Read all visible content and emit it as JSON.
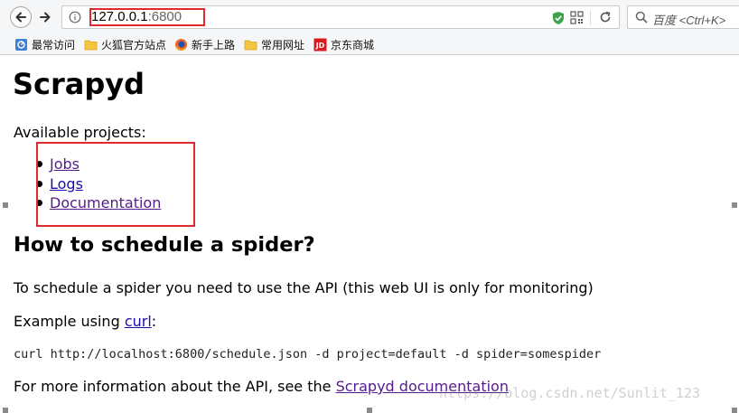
{
  "browser": {
    "url_host": "127.0.0.1",
    "url_port": ":6800",
    "search_placeholder": "百度 <Ctrl+K>"
  },
  "bookmarks": [
    {
      "label": "最常访问",
      "icon": "most-visited-icon"
    },
    {
      "label": "火狐官方站点",
      "icon": "folder-icon"
    },
    {
      "label": "新手上路",
      "icon": "firefox-icon"
    },
    {
      "label": "常用网址",
      "icon": "folder-icon"
    },
    {
      "label": "京东商城",
      "icon": "jd-icon"
    }
  ],
  "page": {
    "title": "Scrapyd",
    "intro": "Available projects:",
    "links": [
      {
        "label": "Jobs"
      },
      {
        "label": "Logs"
      },
      {
        "label": "Documentation"
      }
    ],
    "heading": "How to schedule a spider?",
    "schedule_text": "To schedule a spider you need to use the API (this web UI is only for monitoring)",
    "example_prefix": "Example using ",
    "example_link": "curl",
    "example_suffix": ":",
    "code_example": "curl http://localhost:6800/schedule.json -d project=default -d spider=somespider",
    "more_info_prefix": "For more information about the API, see the ",
    "more_info_link": "Scrapyd documentation"
  },
  "watermark": "https://blog.csdn.net/Sunlit_123",
  "colors": {
    "highlight_red": "#e0282d",
    "link_visited": "#551a8b",
    "link_unvisited": "#1a0dab"
  }
}
